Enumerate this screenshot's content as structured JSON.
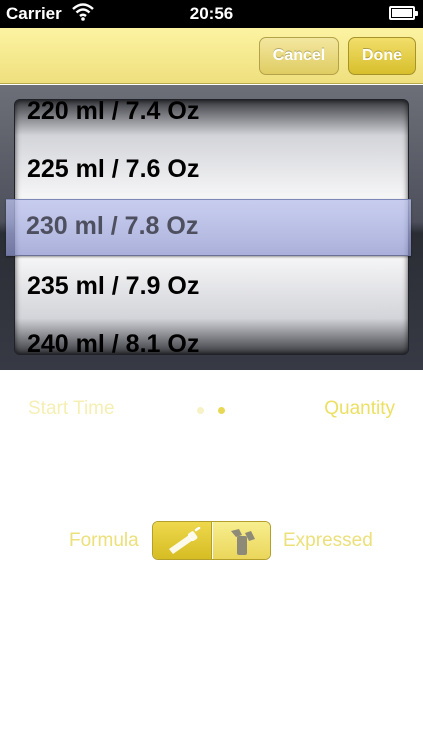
{
  "status_bar": {
    "carrier": "Carrier",
    "time": "20:56"
  },
  "toolbar": {
    "cancel_label": "Cancel",
    "done_label": "Done"
  },
  "picker": {
    "rows": [
      "220 ml / 7.4 Oz",
      "225 ml / 7.6 Oz",
      "230 ml / 7.8 Oz",
      "235 ml / 7.9 Oz",
      "240 ml / 8.1 Oz"
    ],
    "selected": "230 ml / 7.8 Oz"
  },
  "pager": {
    "left_label": "Start Time",
    "right_label": "Quantity",
    "page_count": 2,
    "current_page": 2
  },
  "feed_type": {
    "left_label": "Formula",
    "right_label": "Expressed",
    "selected": "Formula"
  },
  "colors": {
    "accent": "#e8d954",
    "toolbar": "#f5ea90",
    "selection": "#aab0e0"
  },
  "icons": [
    "wifi-icon",
    "battery-icon",
    "bottle-icon",
    "breast-pump-icon"
  ]
}
